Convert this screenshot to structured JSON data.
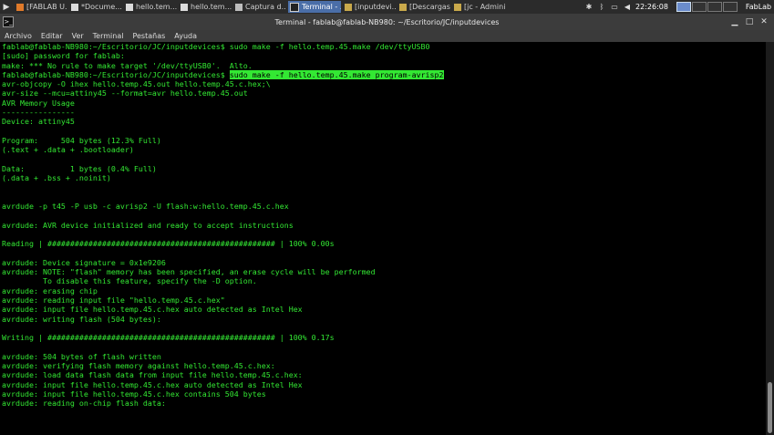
{
  "taskbar": {
    "tasks": [
      {
        "label": "[FABLAB U...",
        "icon": "firefox-icon",
        "active": false
      },
      {
        "label": "*Docume...",
        "icon": "text-editor-icon",
        "active": false
      },
      {
        "label": "hello.tem...",
        "icon": "text-editor-icon",
        "active": false
      },
      {
        "label": "hello.tem...",
        "icon": "text-editor-icon",
        "active": false
      },
      {
        "label": "Captura d...",
        "icon": "screenshot-icon",
        "active": false
      },
      {
        "label": "Terminal - ...",
        "icon": "terminal-icon",
        "active": true
      },
      {
        "label": "[inputdevi...",
        "icon": "folder-icon",
        "active": false
      },
      {
        "label": "[Descargas...",
        "icon": "folder-icon",
        "active": false
      },
      {
        "label": "[jc - Admini...",
        "icon": "folder-icon",
        "active": false
      }
    ],
    "clock": "22:26:08",
    "brand": "FabLab"
  },
  "window": {
    "title": "Terminal - fablab@fablab-NB980: ~/Escritorio/JC/inputdevices"
  },
  "menu": {
    "archivo": "Archivo",
    "editar": "Editar",
    "ver": "Ver",
    "terminal": "Terminal",
    "pestanas": "Pestañas",
    "ayuda": "Ayuda"
  },
  "terminal": {
    "lines": [
      {
        "pre": "fablab@fablab-NB980:~/Escritorio/JC/inputdevices$ sudo make -f hello.temp.45.make /dev/ttyUSB0",
        "hl": ""
      },
      {
        "pre": "[sudo] password for fablab:",
        "hl": ""
      },
      {
        "pre": "make: *** No rule to make target '/dev/ttyUSB0'.  Alto.",
        "hl": ""
      },
      {
        "pre": "fablab@fablab-NB980:~/Escritorio/JC/inputdevices$ ",
        "hl": "sudo make -f hello.temp.45.make program-avrisp2"
      },
      {
        "pre": "avr-objcopy -O ihex hello.temp.45.out hello.temp.45.c.hex;\\",
        "hl": ""
      },
      {
        "pre": "avr-size --mcu=attiny45 --format=avr hello.temp.45.out",
        "hl": ""
      },
      {
        "pre": "AVR Memory Usage",
        "hl": ""
      },
      {
        "pre": "----------------",
        "hl": ""
      },
      {
        "pre": "Device: attiny45",
        "hl": ""
      },
      {
        "pre": "",
        "hl": ""
      },
      {
        "pre": "Program:     504 bytes (12.3% Full)",
        "hl": ""
      },
      {
        "pre": "(.text + .data + .bootloader)",
        "hl": ""
      },
      {
        "pre": "",
        "hl": ""
      },
      {
        "pre": "Data:          1 bytes (0.4% Full)",
        "hl": ""
      },
      {
        "pre": "(.data + .bss + .noinit)",
        "hl": ""
      },
      {
        "pre": "",
        "hl": ""
      },
      {
        "pre": "",
        "hl": ""
      },
      {
        "pre": "avrdude -p t45 -P usb -c avrisp2 -U flash:w:hello.temp.45.c.hex",
        "hl": ""
      },
      {
        "pre": "",
        "hl": ""
      },
      {
        "pre": "avrdude: AVR device initialized and ready to accept instructions",
        "hl": ""
      },
      {
        "pre": "",
        "hl": ""
      },
      {
        "pre": "Reading | ################################################## | 100% 0.00s",
        "hl": ""
      },
      {
        "pre": "",
        "hl": ""
      },
      {
        "pre": "avrdude: Device signature = 0x1e9206",
        "hl": ""
      },
      {
        "pre": "avrdude: NOTE: \"flash\" memory has been specified, an erase cycle will be performed",
        "hl": ""
      },
      {
        "pre": "         To disable this feature, specify the -D option.",
        "hl": ""
      },
      {
        "pre": "avrdude: erasing chip",
        "hl": ""
      },
      {
        "pre": "avrdude: reading input file \"hello.temp.45.c.hex\"",
        "hl": ""
      },
      {
        "pre": "avrdude: input file hello.temp.45.c.hex auto detected as Intel Hex",
        "hl": ""
      },
      {
        "pre": "avrdude: writing flash (504 bytes):",
        "hl": ""
      },
      {
        "pre": "",
        "hl": ""
      },
      {
        "pre": "Writing | ################################################## | 100% 0.17s",
        "hl": ""
      },
      {
        "pre": "",
        "hl": ""
      },
      {
        "pre": "avrdude: 504 bytes of flash written",
        "hl": ""
      },
      {
        "pre": "avrdude: verifying flash memory against hello.temp.45.c.hex:",
        "hl": ""
      },
      {
        "pre": "avrdude: load data flash data from input file hello.temp.45.c.hex:",
        "hl": ""
      },
      {
        "pre": "avrdude: input file hello.temp.45.c.hex auto detected as Intel Hex",
        "hl": ""
      },
      {
        "pre": "avrdude: input file hello.temp.45.c.hex contains 504 bytes",
        "hl": ""
      },
      {
        "pre": "avrdude: reading on-chip flash data:",
        "hl": ""
      }
    ]
  },
  "colors": {
    "terminal_fg": "#33e833",
    "terminal_bg": "#000000",
    "active_task": "#4a6ea8"
  }
}
